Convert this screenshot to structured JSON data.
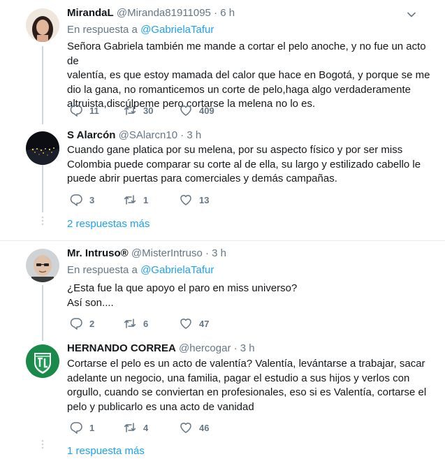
{
  "tweets": [
    {
      "name": "MirandaL",
      "handle": "@Miranda81911095",
      "time": "6 h",
      "reply_prefix": "En respuesta a ",
      "reply_to": "@GabrielaTafur",
      "lines": [
        "Señora Gabriela también me mande a cortar el pelo anoche, y no fue un acto de",
        "valentía, es que estoy mamada del calor que hace en Bogotá, y porque se me",
        "dio la gana, no romanticemos un corte de pelo,haga algo verdaderamente",
        "altruista,discúlpeme pero cortarse la melena no lo es."
      ],
      "replies": "11",
      "retweets": "30",
      "likes": "409"
    },
    {
      "name": "S Alarcón",
      "handle": "@SAlarcn10",
      "time": "3 h",
      "lines": [
        "Cuando gane platica por su melena, por su aspecto físico y por ser miss",
        "Colombia puede comparar su corte al de ella, su largo y estilizado cabello le",
        "puede abrir puertas para comerciales y demás campañas."
      ],
      "replies": "3",
      "retweets": "1",
      "likes": "13",
      "more_replies": "2 respuestas más"
    },
    {
      "name": "Mr. Intruso®",
      "handle": "@MisterIntruso",
      "time": "3 h",
      "reply_prefix": "En respuesta a ",
      "reply_to": "@GabrielaTafur",
      "lines": [
        "¿Esta fue la que apoyo el paro en miss universo?",
        "Así son...."
      ],
      "replies": "2",
      "retweets": "6",
      "likes": "47"
    },
    {
      "name": "HERNANDO CORREA",
      "handle": "@hercogar",
      "time": "3 h",
      "lines": [
        "Cortarse el pelo es un acto de valentía? Valentía, levántarse a trabajar, sacar",
        "adelante un negocio, una familia, pagar el estudio a sus hijos y verlos con",
        "orgullo, cuando se conviertan en profesionales, eso si es Valentía, cortarse el",
        "pelo y publicarlo es una acto de vanidad"
      ],
      "replies": "1",
      "retweets": "4",
      "likes": "46",
      "more_replies": "1 respuesta más"
    }
  ],
  "separator_dot": "·",
  "icons": [
    "reply-icon",
    "retweet-icon",
    "like-icon",
    "chevron-down-icon"
  ],
  "colors": {
    "link": "#1da1f2",
    "muted": "#657786",
    "text": "#14171a"
  }
}
